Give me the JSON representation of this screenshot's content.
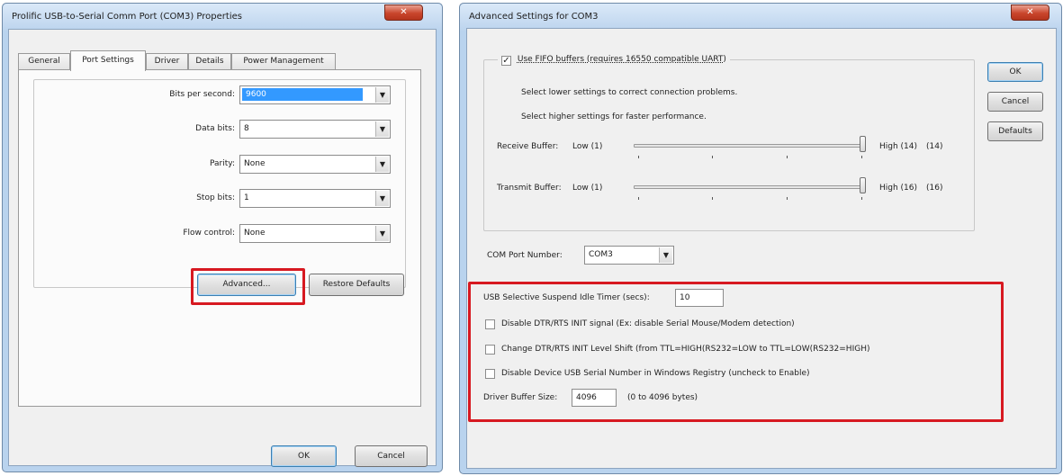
{
  "left_dialog": {
    "title": "Prolific USB-to-Serial Comm Port (COM3) Properties",
    "close_label": "✕",
    "tabs": [
      "General",
      "Port Settings",
      "Driver",
      "Details",
      "Power Management"
    ],
    "active_tab": "Port Settings",
    "fields": {
      "bits_per_second": {
        "label": "Bits per second:",
        "value": "9600"
      },
      "data_bits": {
        "label": "Data bits:",
        "value": "8"
      },
      "parity": {
        "label": "Parity:",
        "value": "None"
      },
      "stop_bits": {
        "label": "Stop bits:",
        "value": "1"
      },
      "flow_control": {
        "label": "Flow control:",
        "value": "None"
      }
    },
    "advanced_label": "Advanced...",
    "restore_label": "Restore Defaults",
    "ok_label": "OK",
    "cancel_label": "Cancel"
  },
  "right_dialog": {
    "title": "Advanced Settings for COM3",
    "close_label": "✕",
    "fifo": {
      "checked": true,
      "label": "Use FIFO buffers (requires 16550 compatible UART)",
      "hint_low": "Select lower settings to correct connection problems.",
      "hint_high": "Select higher settings for faster performance."
    },
    "receive_buffer": {
      "label": "Receive Buffer:",
      "low": "Low (1)",
      "high": "High (14)",
      "value": "(14)"
    },
    "transmit_buffer": {
      "label": "Transmit Buffer:",
      "low": "Low (1)",
      "high": "High (16)",
      "value": "(16)"
    },
    "com_port": {
      "label": "COM Port Number:",
      "value": "COM3"
    },
    "usb_suspend": {
      "label": "USB Selective Suspend Idle Timer (secs):",
      "value": "10"
    },
    "options": [
      {
        "label": "Disable DTR/RTS INIT signal (Ex: disable Serial Mouse/Modem detection)",
        "checked": false
      },
      {
        "label": "Change DTR/RTS INIT Level Shift (from TTL=HIGH(RS232=LOW to TTL=LOW(RS232=HIGH)",
        "checked": false
      },
      {
        "label": "Disable Device USB Serial Number in Windows Registry (uncheck to Enable)",
        "checked": false
      }
    ],
    "driver_buffer": {
      "label": "Driver Buffer Size:",
      "value": "4096",
      "range": "(0 to 4096 bytes)"
    },
    "ok_label": "OK",
    "cancel_label": "Cancel",
    "defaults_label": "Defaults"
  },
  "colors": {
    "highlight_red": "#d71921",
    "selection_blue": "#3399ff",
    "title_frame": "#b9d3ee"
  }
}
